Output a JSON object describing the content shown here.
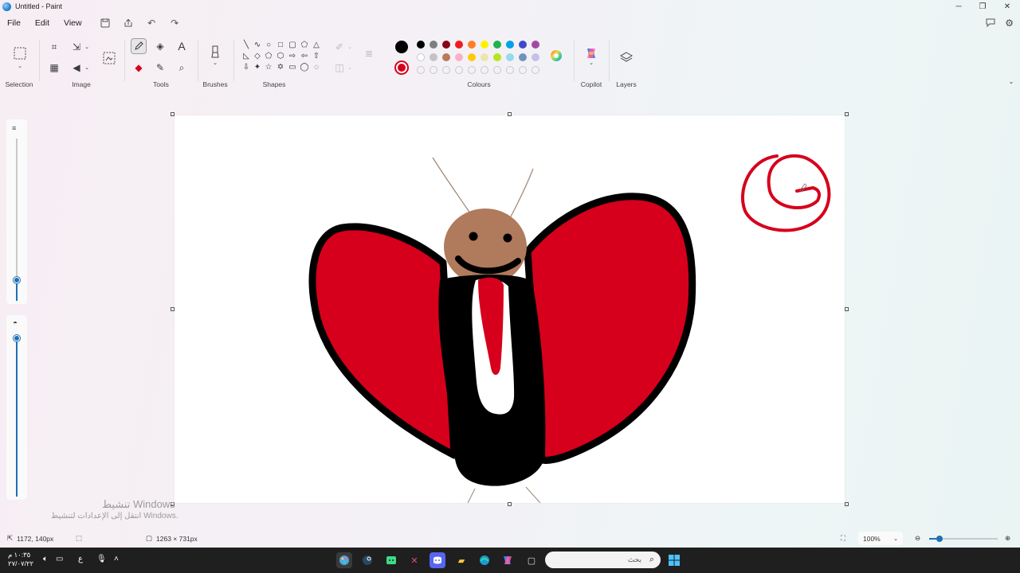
{
  "window": {
    "title": "Untitled - Paint"
  },
  "menu": {
    "file": "File",
    "edit": "Edit",
    "view": "View"
  },
  "ribbon": {
    "selection": "Selection",
    "image": "Image",
    "tools": "Tools",
    "brushes": "Brushes",
    "shapes": "Shapes",
    "colours": "Colours",
    "copilot": "Copilot",
    "layers": "Layers"
  },
  "palette": {
    "primary": "#000000",
    "secondary": "#d6001c",
    "row1": [
      "#000000",
      "#7f7f7f",
      "#880015",
      "#ed1c24",
      "#ff7f27",
      "#fff200",
      "#22b14c",
      "#00a2e8",
      "#3f48cc",
      "#a349a4"
    ],
    "row2": [
      "#ffffff",
      "#c3c3c3",
      "#b97a57",
      "#ffaec9",
      "#ffc90e",
      "#efe4b0",
      "#b5e61d",
      "#99d9ea",
      "#7092be",
      "#c8bfe7"
    ]
  },
  "status": {
    "cursor": "1172, 140px",
    "canvas_size": "1263 × 731px",
    "zoom": "100%"
  },
  "watermark": {
    "line1": "تنشيط Windows",
    "line2": "انتقل إلى الإعدادات لتنشيط Windows."
  },
  "taskbar": {
    "time": "١٠:٣٥ م",
    "date": "٢٧/٠٧/٢٢",
    "lang": "ع",
    "search_placeholder": "بحث"
  },
  "colors": {
    "accent": "#1f6fb5",
    "drawing_red": "#d6001c",
    "drawing_brown": "#b07a5c"
  }
}
